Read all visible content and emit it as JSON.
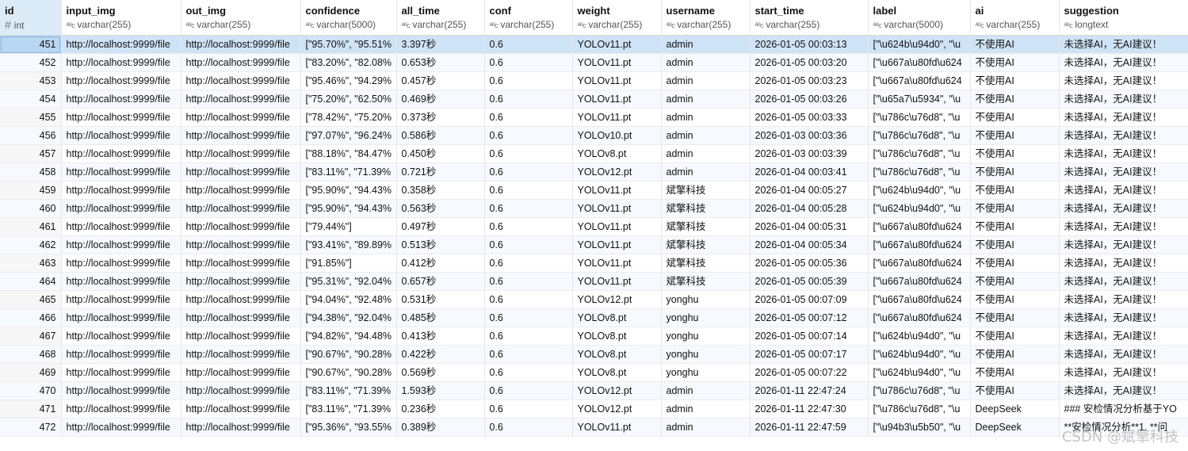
{
  "columns": [
    {
      "name": "id",
      "type": "int"
    },
    {
      "name": "input_img",
      "type": "varchar(255)"
    },
    {
      "name": "out_img",
      "type": "varchar(255)"
    },
    {
      "name": "confidence",
      "type": "varchar(5000)"
    },
    {
      "name": "all_time",
      "type": "varchar(255)"
    },
    {
      "name": "conf",
      "type": "varchar(255)"
    },
    {
      "name": "weight",
      "type": "varchar(255)"
    },
    {
      "name": "username",
      "type": "varchar(255)"
    },
    {
      "name": "start_time",
      "type": "varchar(255)"
    },
    {
      "name": "label",
      "type": "varchar(5000)"
    },
    {
      "name": "ai",
      "type": "varchar(255)"
    },
    {
      "name": "suggestion",
      "type": "longtext"
    }
  ],
  "rows": [
    [
      "451",
      "http://localhost:9999/file",
      "http://localhost:9999/file",
      "[\"95.70%\", \"95.51%",
      "3.397秒",
      "0.6",
      "YOLOv11.pt",
      "admin",
      "2026-01-05 00:03:13",
      "[\"\\u624b\\u94d0\", \"\\u",
      "不使用AI",
      "未选择AI，无AI建议！"
    ],
    [
      "452",
      "http://localhost:9999/file",
      "http://localhost:9999/file",
      "[\"83.20%\", \"82.08%",
      "0.653秒",
      "0.6",
      "YOLOv11.pt",
      "admin",
      "2026-01-05 00:03:20",
      "[\"\\u667a\\u80fd\\u624",
      "不使用AI",
      "未选择AI，无AI建议！"
    ],
    [
      "453",
      "http://localhost:9999/file",
      "http://localhost:9999/file",
      "[\"95.46%\", \"94.29%",
      "0.457秒",
      "0.6",
      "YOLOv11.pt",
      "admin",
      "2026-01-05 00:03:23",
      "[\"\\u667a\\u80fd\\u624",
      "不使用AI",
      "未选择AI，无AI建议！"
    ],
    [
      "454",
      "http://localhost:9999/file",
      "http://localhost:9999/file",
      "[\"75.20%\", \"62.50%",
      "0.469秒",
      "0.6",
      "YOLOv11.pt",
      "admin",
      "2026-01-05 00:03:26",
      "[\"\\u65a7\\u5934\", \"\\u",
      "不使用AI",
      "未选择AI，无AI建议！"
    ],
    [
      "455",
      "http://localhost:9999/file",
      "http://localhost:9999/file",
      "[\"78.42%\", \"75.20%",
      "0.373秒",
      "0.6",
      "YOLOv11.pt",
      "admin",
      "2026-01-05 00:03:33",
      "[\"\\u786c\\u76d8\", \"\\u",
      "不使用AI",
      "未选择AI，无AI建议！"
    ],
    [
      "456",
      "http://localhost:9999/file",
      "http://localhost:9999/file",
      "[\"97.07%\", \"96.24%",
      "0.586秒",
      "0.6",
      "YOLOv10.pt",
      "admin",
      "2026-01-03 00:03:36",
      "[\"\\u786c\\u76d8\", \"\\u",
      "不使用AI",
      "未选择AI，无AI建议！"
    ],
    [
      "457",
      "http://localhost:9999/file",
      "http://localhost:9999/file",
      "[\"88.18%\", \"84.47%",
      "0.450秒",
      "0.6",
      "YOLOv8.pt",
      "admin",
      "2026-01-03 00:03:39",
      "[\"\\u786c\\u76d8\", \"\\u",
      "不使用AI",
      "未选择AI，无AI建议！"
    ],
    [
      "458",
      "http://localhost:9999/file",
      "http://localhost:9999/file",
      "[\"83.11%\", \"71.39%",
      "0.721秒",
      "0.6",
      "YOLOv12.pt",
      "admin",
      "2026-01-04 00:03:41",
      "[\"\\u786c\\u76d8\", \"\\u",
      "不使用AI",
      "未选择AI，无AI建议！"
    ],
    [
      "459",
      "http://localhost:9999/file",
      "http://localhost:9999/file",
      "[\"95.90%\", \"94.43%",
      "0.358秒",
      "0.6",
      "YOLOv11.pt",
      "斌擎科技",
      "2026-01-04 00:05:27",
      "[\"\\u624b\\u94d0\", \"\\u",
      "不使用AI",
      "未选择AI，无AI建议！"
    ],
    [
      "460",
      "http://localhost:9999/file",
      "http://localhost:9999/file",
      "[\"95.90%\", \"94.43%",
      "0.563秒",
      "0.6",
      "YOLOv11.pt",
      "斌擎科技",
      "2026-01-04 00:05:28",
      "[\"\\u624b\\u94d0\", \"\\u",
      "不使用AI",
      "未选择AI，无AI建议！"
    ],
    [
      "461",
      "http://localhost:9999/file",
      "http://localhost:9999/file",
      "[\"79.44%\"]",
      "0.497秒",
      "0.6",
      "YOLOv11.pt",
      "斌擎科技",
      "2026-01-04 00:05:31",
      "[\"\\u667a\\u80fd\\u624",
      "不使用AI",
      "未选择AI，无AI建议！"
    ],
    [
      "462",
      "http://localhost:9999/file",
      "http://localhost:9999/file",
      "[\"93.41%\", \"89.89%",
      "0.513秒",
      "0.6",
      "YOLOv11.pt",
      "斌擎科技",
      "2026-01-04 00:05:34",
      "[\"\\u667a\\u80fd\\u624",
      "不使用AI",
      "未选择AI，无AI建议！"
    ],
    [
      "463",
      "http://localhost:9999/file",
      "http://localhost:9999/file",
      "[\"91.85%\"]",
      "0.412秒",
      "0.6",
      "YOLOv11.pt",
      "斌擎科技",
      "2026-01-05 00:05:36",
      "[\"\\u667a\\u80fd\\u624",
      "不使用AI",
      "未选择AI，无AI建议！"
    ],
    [
      "464",
      "http://localhost:9999/file",
      "http://localhost:9999/file",
      "[\"95.31%\", \"92.04%",
      "0.657秒",
      "0.6",
      "YOLOv11.pt",
      "斌擎科技",
      "2026-01-05 00:05:39",
      "[\"\\u667a\\u80fd\\u624",
      "不使用AI",
      "未选择AI，无AI建议！"
    ],
    [
      "465",
      "http://localhost:9999/file",
      "http://localhost:9999/file",
      "[\"94.04%\", \"92.48%",
      "0.531秒",
      "0.6",
      "YOLOv12.pt",
      "yonghu",
      "2026-01-05 00:07:09",
      "[\"\\u667a\\u80fd\\u624",
      "不使用AI",
      "未选择AI，无AI建议！"
    ],
    [
      "466",
      "http://localhost:9999/file",
      "http://localhost:9999/file",
      "[\"94.38%\", \"92.04%",
      "0.485秒",
      "0.6",
      "YOLOv8.pt",
      "yonghu",
      "2026-01-05 00:07:12",
      "[\"\\u667a\\u80fd\\u624",
      "不使用AI",
      "未选择AI，无AI建议！"
    ],
    [
      "467",
      "http://localhost:9999/file",
      "http://localhost:9999/file",
      "[\"94.82%\", \"94.48%",
      "0.413秒",
      "0.6",
      "YOLOv8.pt",
      "yonghu",
      "2026-01-05 00:07:14",
      "[\"\\u624b\\u94d0\", \"\\u",
      "不使用AI",
      "未选择AI，无AI建议！"
    ],
    [
      "468",
      "http://localhost:9999/file",
      "http://localhost:9999/file",
      "[\"90.67%\", \"90.28%",
      "0.422秒",
      "0.6",
      "YOLOv8.pt",
      "yonghu",
      "2026-01-05 00:07:17",
      "[\"\\u624b\\u94d0\", \"\\u",
      "不使用AI",
      "未选择AI，无AI建议！"
    ],
    [
      "469",
      "http://localhost:9999/file",
      "http://localhost:9999/file",
      "[\"90.67%\", \"90.28%",
      "0.569秒",
      "0.6",
      "YOLOv8.pt",
      "yonghu",
      "2026-01-05 00:07:22",
      "[\"\\u624b\\u94d0\", \"\\u",
      "不使用AI",
      "未选择AI，无AI建议！"
    ],
    [
      "470",
      "http://localhost:9999/file",
      "http://localhost:9999/file",
      "[\"83.11%\", \"71.39%",
      "1.593秒",
      "0.6",
      "YOLOv12.pt",
      "admin",
      "2026-01-11 22:47:24",
      "[\"\\u786c\\u76d8\", \"\\u",
      "不使用AI",
      "未选择AI，无AI建议！"
    ],
    [
      "471",
      "http://localhost:9999/file",
      "http://localhost:9999/file",
      "[\"83.11%\", \"71.39%",
      "0.236秒",
      "0.6",
      "YOLOv12.pt",
      "admin",
      "2026-01-11 22:47:30",
      "[\"\\u786c\\u76d8\", \"\\u",
      "DeepSeek",
      "### 安检情况分析基于YO"
    ],
    [
      "472",
      "http://localhost:9999/file",
      "http://localhost:9999/file",
      "[\"95.36%\", \"93.55%",
      "0.389秒",
      "0.6",
      "YOLOv11.pt",
      "admin",
      "2026-01-11 22:47:59",
      "[\"\\u94b3\\u5b50\", \"\\u",
      "DeepSeek",
      "**安检情况分析**1. **问"
    ]
  ],
  "selected_row": 0,
  "watermark": "CSDN @斌擎科技"
}
